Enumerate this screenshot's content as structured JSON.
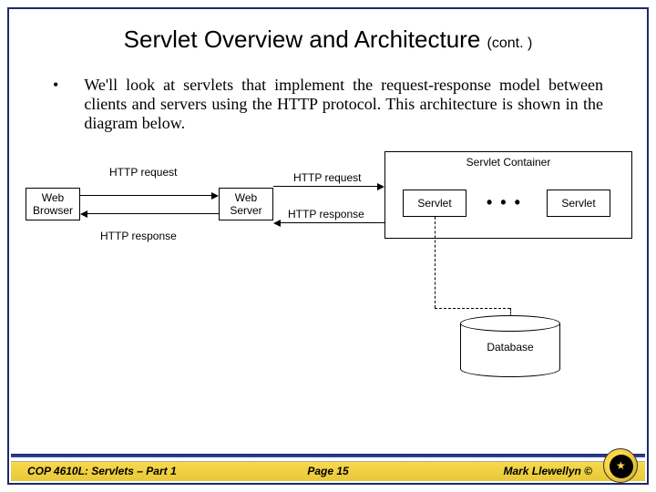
{
  "title": {
    "main": "Servlet Overview and Architecture",
    "cont": "(cont. )"
  },
  "bullet": "•",
  "body": "We'll look at servlets that implement the request-response model between clients and servers using the HTTP protocol.   This architecture is shown in the diagram below.",
  "diagram": {
    "web_browser": "Web\nBrowser",
    "web_server": "Web\nServer",
    "http_request_1": "HTTP request",
    "http_response_1": "HTTP response",
    "http_request_2": "HTTP request",
    "http_response_2": "HTTP response",
    "servlet_container": "Servlet Container",
    "servlet_1": "Servlet",
    "servlet_2": "Servlet",
    "dots": "• • •",
    "database": "Database"
  },
  "footer": {
    "left": "COP 4610L: Servlets – Part 1",
    "center": "Page 15",
    "right": "Mark Llewellyn ©"
  }
}
